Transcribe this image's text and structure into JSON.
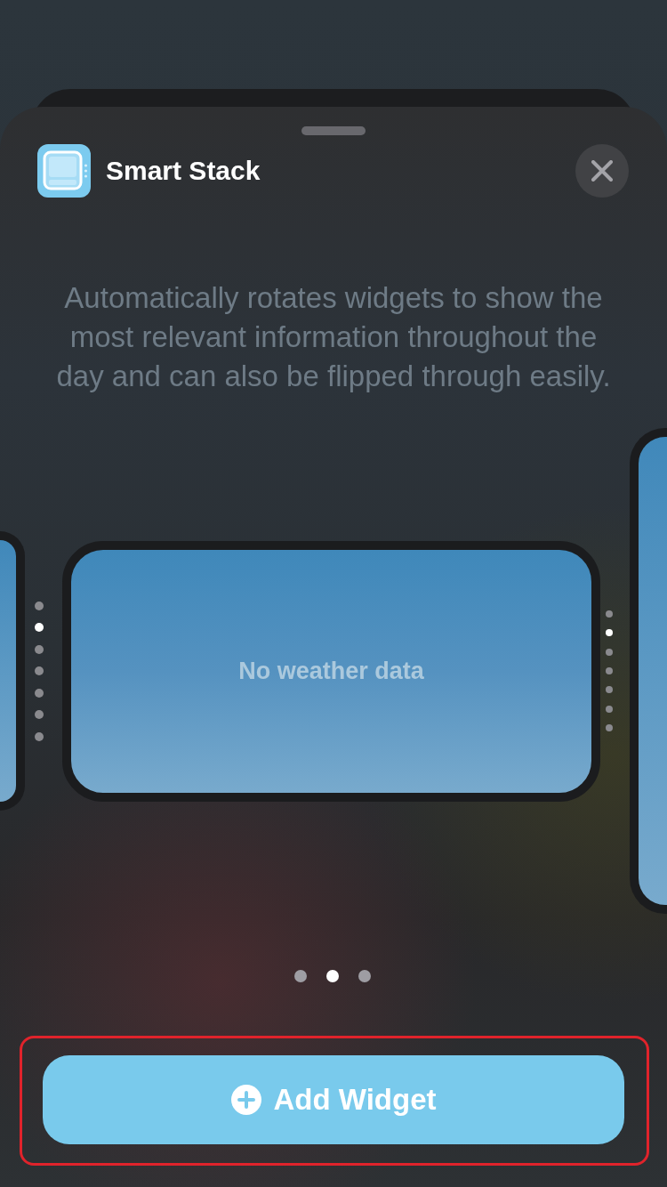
{
  "header": {
    "app_name": "Smart Stack"
  },
  "description": "Automatically rotates widgets to show the most relevant information throughout the day and can also be flipped through easily.",
  "carousel": {
    "stack_dots_left": [
      {
        "selected": false
      },
      {
        "selected": true
      },
      {
        "selected": false
      },
      {
        "selected": false
      },
      {
        "selected": false
      },
      {
        "selected": false
      },
      {
        "selected": false
      }
    ],
    "widget": {
      "message": "No weather data"
    },
    "stack_dots_right": [
      {
        "selected": false
      },
      {
        "selected": true
      },
      {
        "selected": false
      },
      {
        "selected": false
      },
      {
        "selected": false
      },
      {
        "selected": false
      },
      {
        "selected": false
      }
    ],
    "pages": [
      {
        "selected": false
      },
      {
        "selected": true
      },
      {
        "selected": false
      }
    ]
  },
  "add_button": {
    "label": "Add Widget"
  }
}
